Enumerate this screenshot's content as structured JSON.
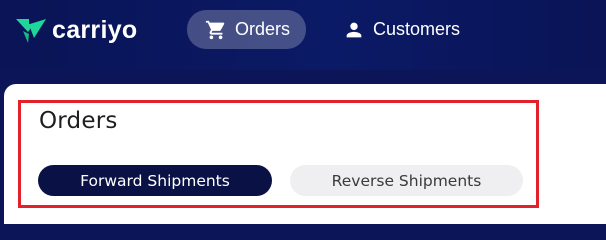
{
  "header": {
    "brand_name": "carriyo",
    "brand_color": "#1fd69a",
    "nav": [
      {
        "label": "Orders",
        "icon": "cart-icon",
        "active": true
      },
      {
        "label": "Customers",
        "icon": "person-icon",
        "active": false
      }
    ]
  },
  "main": {
    "title": "Orders",
    "tabs": [
      {
        "label": "Forward Shipments",
        "selected": true
      },
      {
        "label": "Reverse Shipments",
        "selected": false
      }
    ]
  },
  "highlight_color": "#e3212a"
}
